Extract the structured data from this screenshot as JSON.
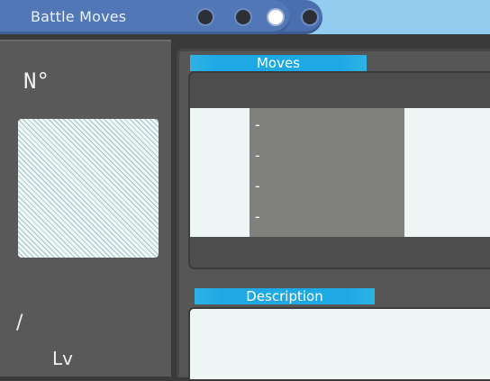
{
  "header": {
    "title": "Battle Moves",
    "page_dots": [
      {
        "icon": "dot-icon",
        "active": false
      },
      {
        "icon": "dot-icon",
        "active": false
      },
      {
        "icon": "dot-icon",
        "active": true
      },
      {
        "icon": "dot-icon",
        "active": false
      }
    ]
  },
  "info_panel": {
    "number_label": "N°",
    "hp_separator": "/",
    "level_label": "Lv"
  },
  "moves_panel": {
    "title": "Moves",
    "slots": [
      "-",
      "-",
      "-",
      "-"
    ]
  },
  "description_panel": {
    "title": "Description",
    "text": ""
  },
  "colors": {
    "title_bar": "#4a6fae",
    "accent_blue": "#1ea9e5",
    "panel_gray": "#595959",
    "light_panel": "#eef5f5"
  }
}
